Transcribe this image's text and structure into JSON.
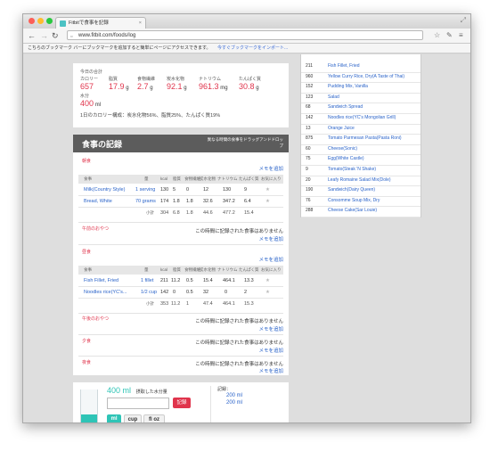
{
  "browser": {
    "tab_title": "Fitbitで食事を記録",
    "url": "www.fitbit.com/foods/log",
    "bookmark_bar_text": "こちらのブックマーク バーにブックマークを追加すると簡単にページにアクセスできます。",
    "bookmark_bar_link": "今すぐブックマークをインポート..."
  },
  "summary": {
    "header": "今日の合計",
    "calories_label": "カロリー",
    "calories_value": "657",
    "fat_label": "脂質",
    "fat_value": "17.9",
    "fat_unit": "g",
    "fiber_label": "食物繊維",
    "fiber_value": "2.7",
    "fiber_unit": "g",
    "carbs_label": "炭水化物",
    "carbs_value": "92.1",
    "carbs_unit": "g",
    "sodium_label": "ナトリウム",
    "sodium_value": "961.3",
    "sodium_unit": "mg",
    "protein_label": "たんぱく質",
    "protein_value": "30.8",
    "protein_unit": "g",
    "water_label": "水分",
    "water_value": "400",
    "water_unit": "ml",
    "breakdown": "1日のカロリー構成：炭水化物56%、脂質25%、たんぱく質19%"
  },
  "food_log": {
    "title": "食事の記録",
    "drag_hint": "異なる時間の食事をドラッグアンドドロップ",
    "add_memo": "メモを追加",
    "no_food_msg": "この時間に記録された食事はありません",
    "columns": [
      "食事",
      "量",
      "kcal",
      "脂質",
      "食物繊維",
      "炭水化物",
      "ナトリウム",
      "たんぱく質",
      "お気に入り"
    ],
    "total_label": "小計",
    "breakfast": {
      "label": "朝食",
      "rows": [
        {
          "name": "Milk(Country Style)",
          "amount": "1 serving",
          "kcal": "130",
          "fat": "5",
          "fiber": "0",
          "carbs": "12",
          "sodium": "130",
          "protein": "9"
        },
        {
          "name": "Bread, White",
          "amount": "70 grams",
          "kcal": "174",
          "fat": "1.8",
          "fiber": "1.8",
          "carbs": "32.6",
          "sodium": "347.2",
          "protein": "6.4"
        }
      ],
      "total": {
        "kcal": "304",
        "fat": "6.8",
        "fiber": "1.8",
        "carbs": "44.6",
        "sodium": "477.2",
        "protein": "15.4"
      }
    },
    "morning_snack_label": "午前のおやつ",
    "lunch": {
      "label": "昼食",
      "rows": [
        {
          "name": "Fish Fillet, Fried",
          "amount": "1 fillet",
          "kcal": "211",
          "fat": "11.2",
          "fiber": "0.5",
          "carbs": "15.4",
          "sodium": "464.1",
          "protein": "13.3"
        },
        {
          "name": "Noodles rice(YC's...",
          "amount": "1/2 cup",
          "kcal": "142",
          "fat": "0",
          "fiber": "0.5",
          "carbs": "32",
          "sodium": "0",
          "protein": "2"
        }
      ],
      "total": {
        "kcal": "353",
        "fat": "11.2",
        "fiber": "1",
        "carbs": "47.4",
        "sodium": "464.1",
        "protein": "15.3"
      }
    },
    "afternoon_snack_label": "午後のおやつ",
    "dinner_label": "夕食",
    "late_label": "夜食"
  },
  "water": {
    "amount_text": "400 ml",
    "amount_desc": "摂取した水分量",
    "log_button": "記録",
    "units": [
      "ml",
      "cup",
      "fl oz"
    ],
    "log_title": "記録：",
    "entries": [
      "200 ml",
      "200 ml"
    ]
  },
  "recent_foods": [
    {
      "cal": "211",
      "name": "Fish Fillet, Fried"
    },
    {
      "cal": "960",
      "name": "Yellow Curry Rice, Dry(A Taste of Thai)"
    },
    {
      "cal": "152",
      "name": "Pudding Mix, Vanilla"
    },
    {
      "cal": "123",
      "name": "Salad"
    },
    {
      "cal": "68",
      "name": "Sandwich Spread"
    },
    {
      "cal": "142",
      "name": "Noodles rice(YC's Mongolian Grill)"
    },
    {
      "cal": "13",
      "name": "Orange Juice"
    },
    {
      "cal": "875",
      "name": "Tomato Parmesan Pasta(Pasta Roni)"
    },
    {
      "cal": "60",
      "name": "Cheese(Sonic)"
    },
    {
      "cal": "75",
      "name": "Egg(White Castle)"
    },
    {
      "cal": "9",
      "name": "Tomato(Steak 'N Shake)"
    },
    {
      "cal": "20",
      "name": "Leafy Romaine Salad Mix(Dole)"
    },
    {
      "cal": "190",
      "name": "Sandwich(Dairy Queen)"
    },
    {
      "cal": "76",
      "name": "Consomme Soup Mix, Dry"
    },
    {
      "cal": "288",
      "name": "Cheese Cake(Sar Louie)"
    }
  ],
  "colors": {
    "accent_red": "#e0344c",
    "link_blue": "#2a63c9",
    "header_dark": "#5c5c5c",
    "water_teal": "#2ec4b6"
  }
}
